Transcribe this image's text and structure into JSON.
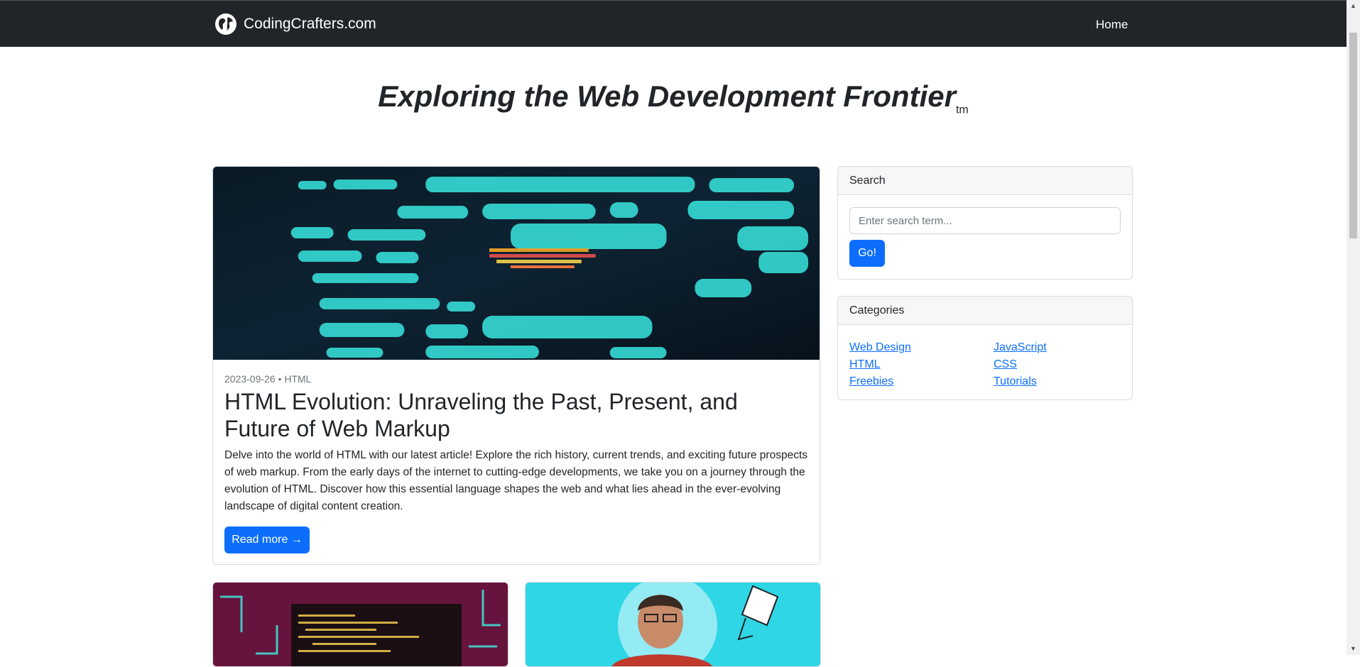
{
  "navbar": {
    "brand": "CodingCrafters.com",
    "home_link": "Home"
  },
  "hero": {
    "title": "Exploring the Web Development Frontier",
    "trademark": "tm"
  },
  "featured_post": {
    "date": "2023-09-26",
    "separator": "•",
    "category": "HTML",
    "title": "HTML Evolution: Unraveling the Past, Present, and Future of Web Markup",
    "excerpt": "Delve into the world of HTML with our latest article! Explore the rich history, current trends, and exciting future prospects of web markup. From the early days of the internet to cutting-edge developments, we take you on a journey through the evolution of HTML. Discover how this essential language shapes the web and what lies ahead in the ever-evolving landscape of digital content creation.",
    "read_more": "Read more →"
  },
  "sidebar": {
    "search": {
      "header": "Search",
      "placeholder": "Enter search term...",
      "button": "Go!"
    },
    "categories": {
      "header": "Categories",
      "items": [
        "Web Design",
        "JavaScript",
        "HTML",
        "CSS",
        "Freebies",
        "Tutorials"
      ]
    }
  },
  "colors": {
    "navbar_bg": "#212529",
    "primary": "#0d6efd",
    "text": "#212529",
    "muted": "#6c757d"
  },
  "icons": {
    "brand": "globe-icon",
    "scroll_up": "arrow-up-icon",
    "scroll_down": "arrow-down-icon"
  }
}
